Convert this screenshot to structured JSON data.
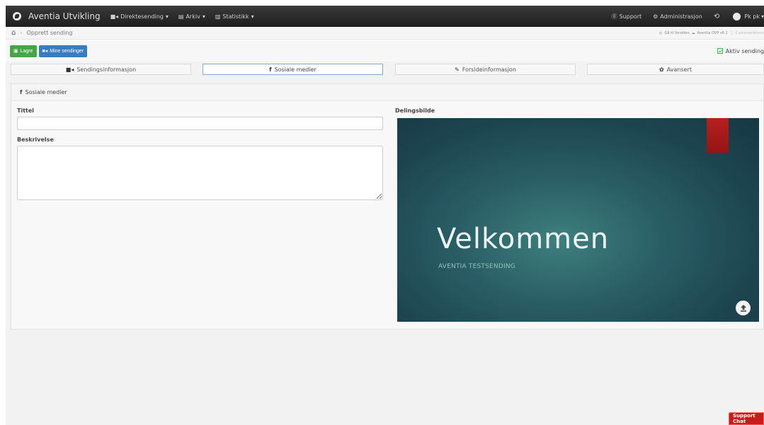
{
  "navbar": {
    "brand": "Aventia Utvikling",
    "items": [
      {
        "label": "Direktesending",
        "icon": "video-icon"
      },
      {
        "label": "Arkiv",
        "icon": "archive-icon"
      },
      {
        "label": "Statistikk",
        "icon": "bar-chart-icon"
      }
    ],
    "caret": "▾",
    "support": "Support",
    "admin": "Administrasjon",
    "user": "Pk pk"
  },
  "breadcrumb": {
    "current": "Opprett sending",
    "separator": "›",
    "goto_front": "Gå til forsiden",
    "version": "Aventia OVP v6.1",
    "customer_admin": "CustomerAdmin"
  },
  "actions": {
    "save_label": "Lagre",
    "my_broadcasts_label": "Mine sendinger",
    "active_label": "Aktiv sending"
  },
  "tabs": [
    {
      "label": "Sendingsinformasjon",
      "icon": "video-icon"
    },
    {
      "label": "Sosiale medier",
      "icon": "facebook-icon"
    },
    {
      "label": "Forsideinformasjon",
      "icon": "pencil-icon"
    },
    {
      "label": "Avansert",
      "icon": "gear-icon"
    }
  ],
  "panel": {
    "heading": "Sosiale medier",
    "title_label": "Tittel",
    "title_value": "",
    "description_label": "Beskrivelse",
    "description_value": "",
    "share_image_label": "Delingsbilde"
  },
  "share_image": {
    "title": "Velkommen",
    "subtitle": "AVENTIA TESTSENDING"
  },
  "support_chat": "Support Chat",
  "colors": {
    "navbar": "#2a2a2a",
    "save_button": "#45a548",
    "my_broadcasts_button": "#3a7cc0",
    "support_chat": "#c91b1b",
    "bookmark": "#a81a1a"
  }
}
